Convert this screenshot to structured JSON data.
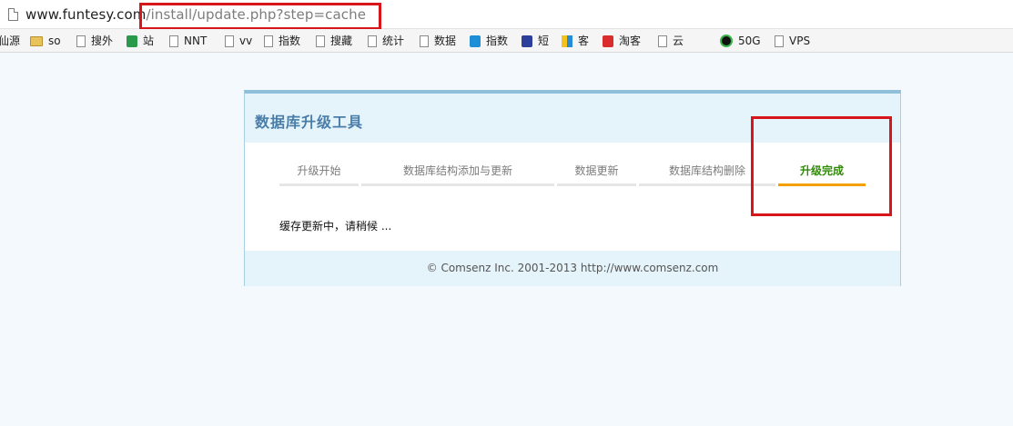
{
  "browser": {
    "url_host": "www.funtesy.com",
    "url_path": "/install/update.php?step=cache",
    "bookmarks": [
      {
        "label": "仙源",
        "icon": "none"
      },
      {
        "label": "so",
        "icon": "folder-icon"
      },
      {
        "label": "搜外",
        "icon": "page-icon"
      },
      {
        "label": "站",
        "icon": "site-icon"
      },
      {
        "label": "NNT",
        "icon": "page-icon"
      },
      {
        "label": "vv",
        "icon": "page-icon"
      },
      {
        "label": "指数",
        "icon": "page-icon"
      },
      {
        "label": "搜藏",
        "icon": "page-icon"
      },
      {
        "label": "统计",
        "icon": "page-icon"
      },
      {
        "label": "数据",
        "icon": "page-icon"
      },
      {
        "label": "指数",
        "icon": "zhi-icon"
      },
      {
        "label": "短",
        "icon": "paw-icon"
      },
      {
        "label": "客",
        "icon": "colorful-icon"
      },
      {
        "label": "淘客",
        "icon": "red-logo-icon"
      },
      {
        "label": "云",
        "icon": "page-icon"
      },
      {
        "label": "50G",
        "icon": "circle-icon"
      },
      {
        "label": "VPS",
        "icon": "page-icon"
      }
    ]
  },
  "installer": {
    "title": "数据库升级工具",
    "steps": [
      {
        "label": "升级开始",
        "active": false
      },
      {
        "label": "数据库结构添加与更新",
        "active": false
      },
      {
        "label": "数据更新",
        "active": false
      },
      {
        "label": "数据库结构删除",
        "active": false
      },
      {
        "label": "升级完成",
        "active": true
      }
    ],
    "message": "缓存更新中，请稍候 ...",
    "footer": "© Comsenz Inc. 2001-2013 http://www.comsenz.com"
  },
  "colors": {
    "annotation_red": "#d8151b",
    "active_step_text": "#2f8a06",
    "active_step_underline": "#f2a100",
    "title_blue": "#4a7ea8"
  }
}
